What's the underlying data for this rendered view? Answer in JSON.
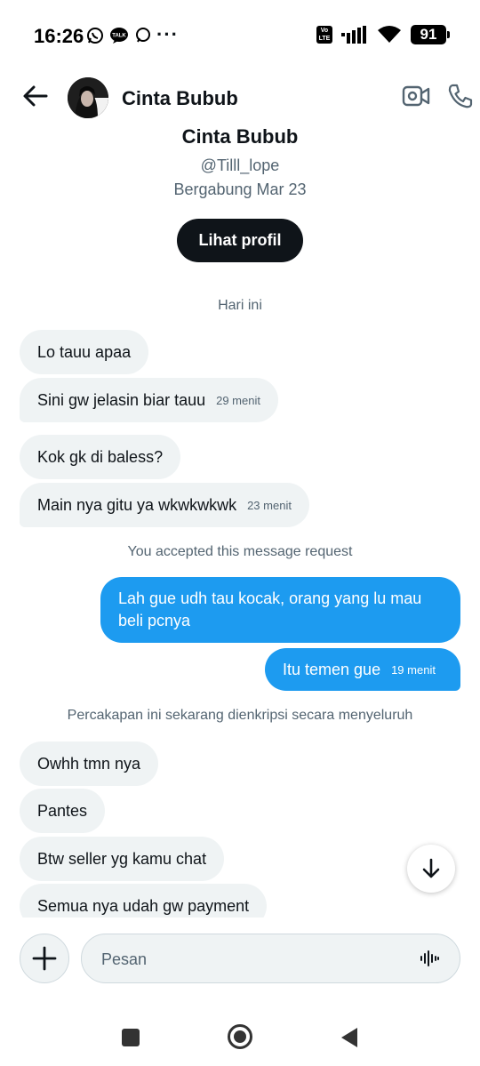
{
  "status_bar": {
    "time": "16:26",
    "battery": "91",
    "network_badge_top": "Vo",
    "network_badge_bottom": "LTE",
    "talk_badge": "TALK",
    "more_dots": "···"
  },
  "header": {
    "name": "Cinta Bubub"
  },
  "profile": {
    "name": "Cinta Bubub",
    "handle": "@Tilll_lope",
    "joined": "Bergabung Mar 23",
    "view_profile_label": "Lihat profil"
  },
  "conversation": {
    "day_label": "Hari ini",
    "accepted_note": "You accepted this message request",
    "encrypted_note": "Percakapan ini sekarang dienkripsi secara menyeluruh",
    "messages": [
      {
        "side": "in",
        "text": "Lo tauu apaa",
        "time": ""
      },
      {
        "side": "in",
        "text": "Sini gw jelasin biar tauu",
        "time": "29 menit"
      },
      {
        "side": "in",
        "text": "Kok gk di baless?",
        "time": ""
      },
      {
        "side": "in",
        "text": "Main nya gitu ya wkwkwkwk",
        "time": "23 menit"
      },
      {
        "side": "out",
        "text": "Lah gue udh tau kocak, orang yang lu mau beli pcnya",
        "time": ""
      },
      {
        "side": "out",
        "text": "Itu temen gue",
        "time": "19 menit"
      },
      {
        "side": "in",
        "text": "Owhh tmn nya",
        "time": ""
      },
      {
        "side": "in",
        "text": "Pantes",
        "time": ""
      },
      {
        "side": "in",
        "text": "Btw seller yg kamu chat",
        "time": ""
      },
      {
        "side": "in",
        "text": "Semua nya udah gw payment",
        "time": ""
      }
    ]
  },
  "composer": {
    "placeholder": "Pesan"
  },
  "colors": {
    "accent": "#1d9bf0",
    "incoming_bubble": "#eff3f4",
    "secondary_text": "#536471",
    "primary_text": "#0f1419"
  },
  "icons": {
    "back": "arrow-left-icon",
    "video": "video-camera-icon",
    "call": "phone-icon",
    "scroll": "arrow-down-icon",
    "add": "plus-icon",
    "voice": "voice-wave-icon"
  }
}
